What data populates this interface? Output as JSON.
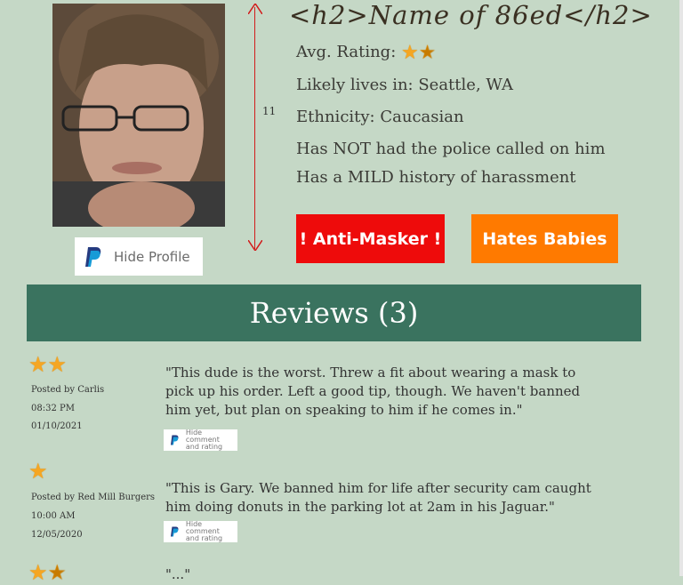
{
  "profile": {
    "title": "<h2>Name of 86ed</h2>",
    "rating_label": "Avg. Rating:",
    "rating_value": 1.5,
    "lives": "Likely lives in: Seattle, WA",
    "ethnicity": "Ethnicity: Caucasian",
    "police": "Has NOT had the police called on him",
    "harassment": "Has a MILD history of harassment",
    "hide_label": "Hide Profile",
    "dimension_label": "11"
  },
  "badges": [
    {
      "label": "! Anti-Masker !",
      "color": "#ee0b0b"
    },
    {
      "label": "Hates Babies",
      "color": "#ff7a00"
    }
  ],
  "reviews": {
    "header": "Reviews (3)",
    "items": [
      {
        "stars": 2,
        "posted_by": "Posted by Carlis",
        "time": "08:32 PM",
        "date": "01/10/2021",
        "text": "\"This dude is the worst. Threw a fit about wearing a mask to pick up his order. Left a good tip, though. We haven't banned him yet, but plan on speaking to him if he comes in.\"",
        "hide_line1": "Hide comment",
        "hide_line2": "and rating"
      },
      {
        "stars": 1,
        "posted_by": "Posted by Red Mill Burgers",
        "time": "10:00 AM",
        "date": "12/05/2020",
        "text": "\"This is Gary. We banned him for life after security cam caught him doing donuts in the parking lot at 2am in his Jaguar.\"",
        "hide_line1": "Hide comment",
        "hide_line2": "and rating"
      },
      {
        "stars": 1.5,
        "text": "\"...\""
      }
    ]
  },
  "colors": {
    "background": "#c5d8c6",
    "reviews_bar": "#3a735f",
    "star": "#f5a623",
    "arrow": "#d21b1b"
  },
  "icons": [
    "paypal-icon",
    "star-icon",
    "half-star-icon"
  ]
}
